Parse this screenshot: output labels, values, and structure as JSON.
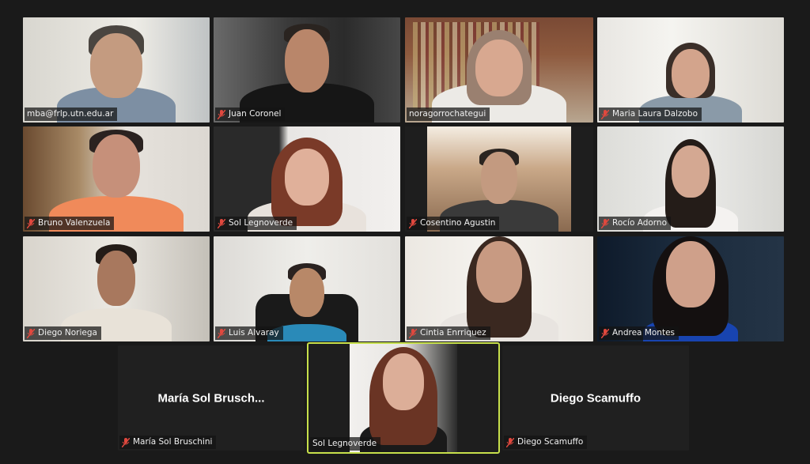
{
  "meeting": {
    "participants": [
      {
        "id": "p1",
        "name": "mba@frlp.utn.edu.ar",
        "muted": false
      },
      {
        "id": "p2",
        "name": "Juan Coronel",
        "muted": true
      },
      {
        "id": "p3",
        "name": "noragorrochategui",
        "muted": false
      },
      {
        "id": "p4",
        "name": "Maria Laura Dalzobo",
        "muted": true
      },
      {
        "id": "p5",
        "name": "Bruno Valenzuela",
        "muted": true
      },
      {
        "id": "p6",
        "name": "Sol Legnoverde",
        "muted": true
      },
      {
        "id": "p7",
        "name": "Cosentino Agustin",
        "muted": true
      },
      {
        "id": "p8",
        "name": "Rocío Adorno",
        "muted": true
      },
      {
        "id": "p9",
        "name": "Diego Noriega",
        "muted": true
      },
      {
        "id": "p10",
        "name": "Luis Alvaray",
        "muted": true
      },
      {
        "id": "p11",
        "name": "Cintia Enrriquez",
        "muted": true
      },
      {
        "id": "p12",
        "name": "Andrea Montes",
        "muted": true
      },
      {
        "id": "p13",
        "name": "María Sol Bruschini",
        "display_center": "María  Sol  Brusch...",
        "video": false,
        "muted": true
      },
      {
        "id": "p14",
        "name": "Sol Legnoverde",
        "video": true,
        "active_speaker": true,
        "muted": false
      },
      {
        "id": "p15",
        "name": "Diego Scamuffo",
        "display_center": "Diego Scamuffo",
        "video": false,
        "muted": true
      }
    ],
    "colors": {
      "background": "#1a1a1a",
      "active_speaker_border": "#c7e04b",
      "muted_icon": "#e0483e"
    },
    "icons": {
      "muted": "mic-muted-icon"
    }
  }
}
